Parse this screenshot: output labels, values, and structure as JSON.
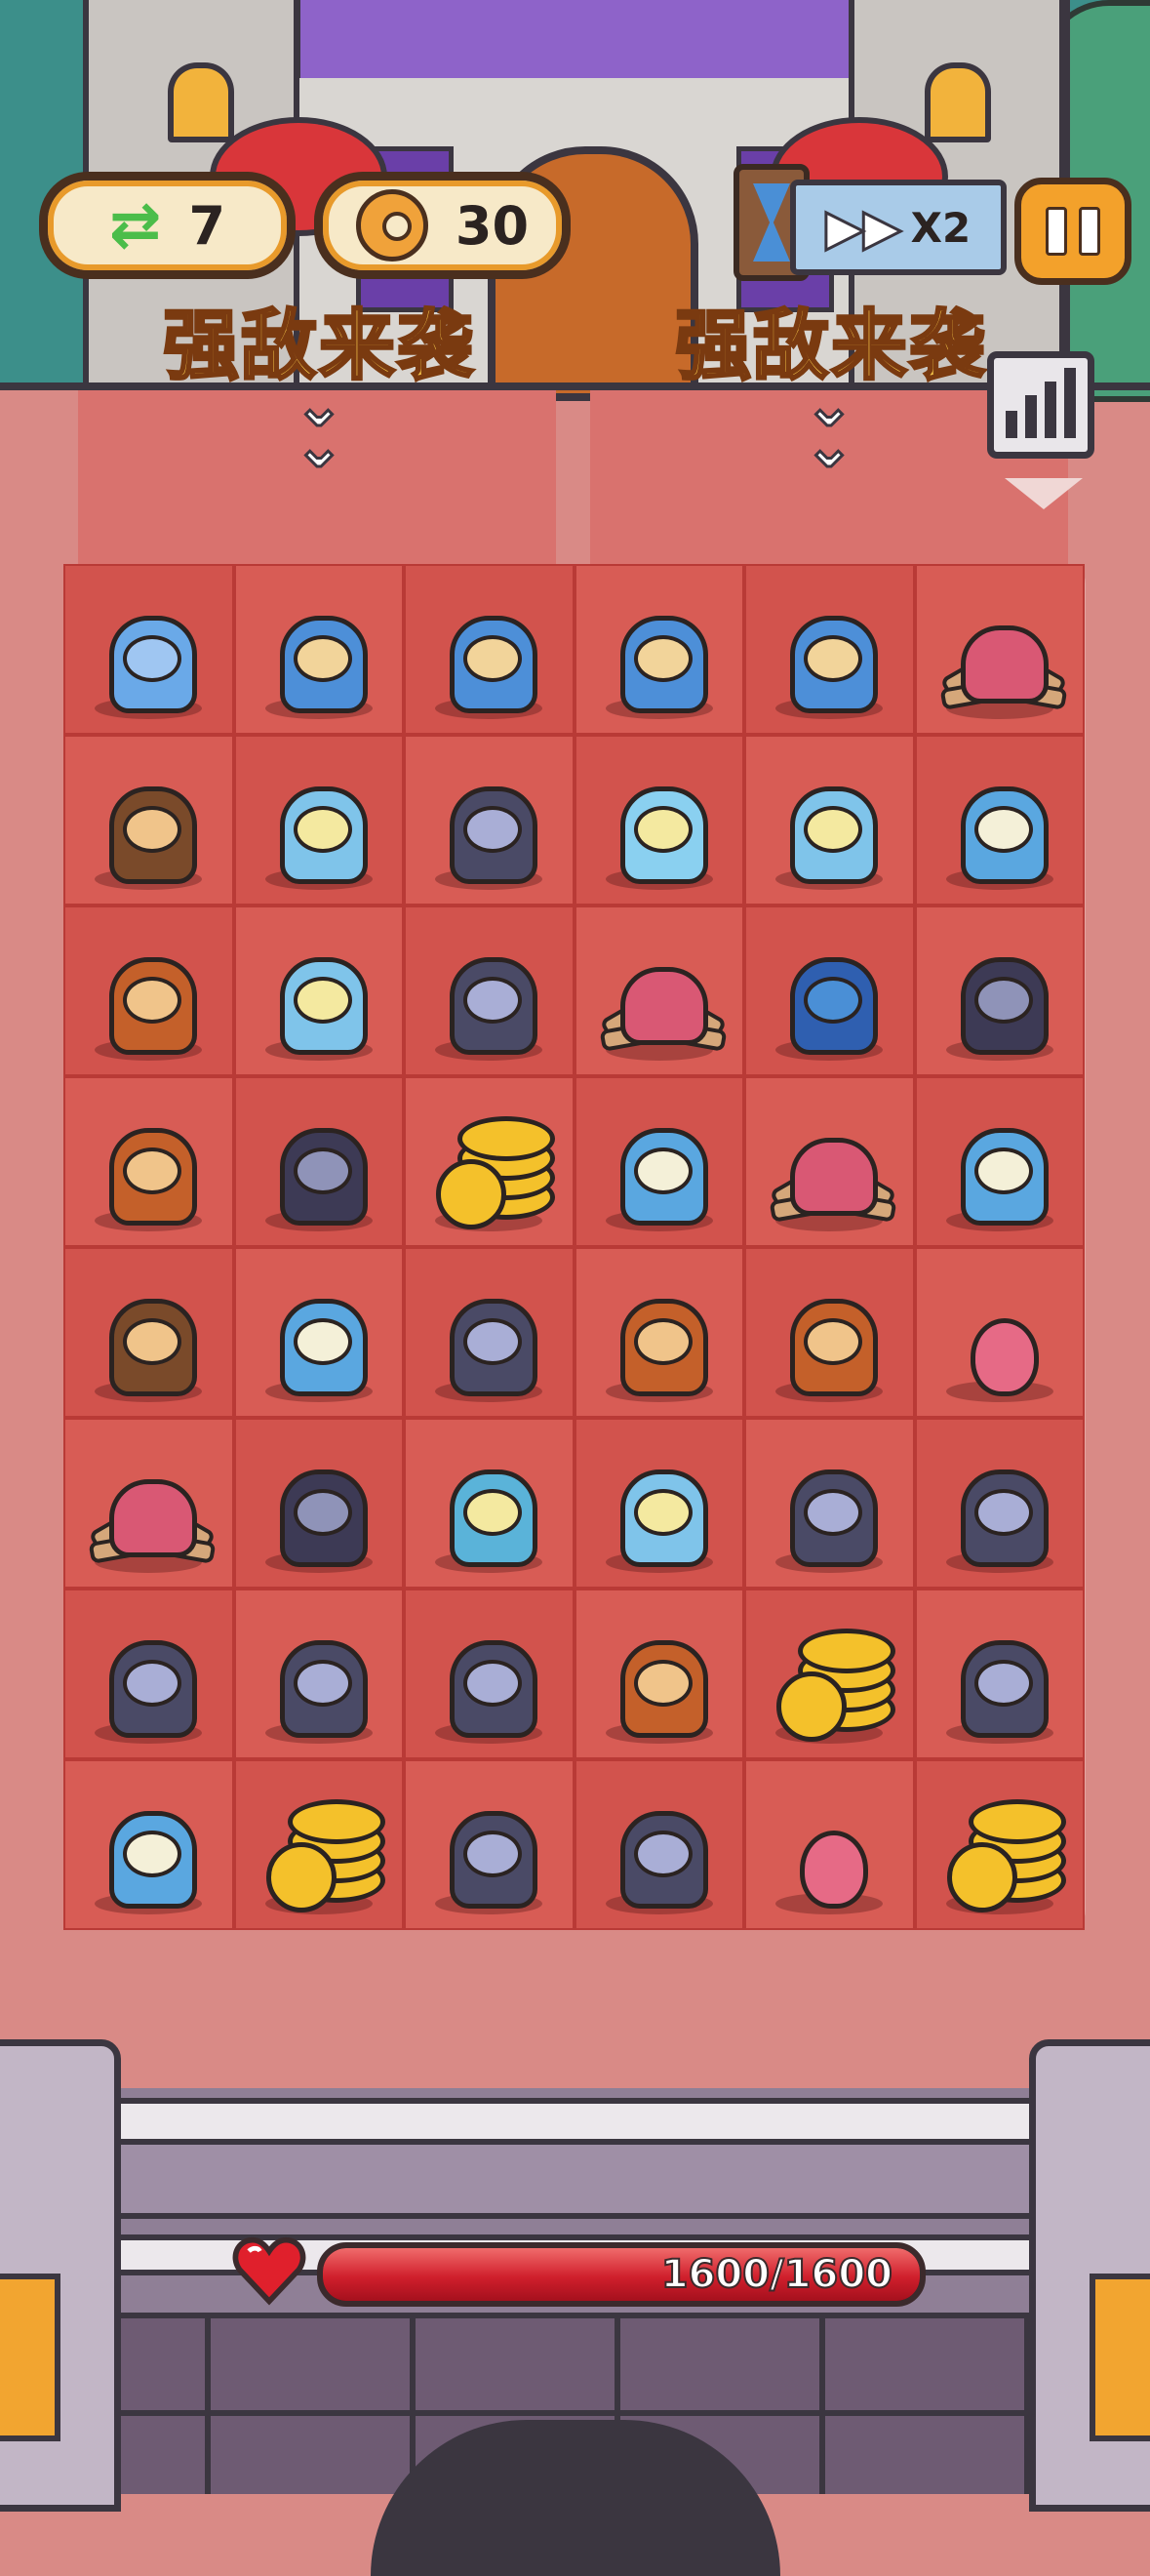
{
  "hud": {
    "swaps": "7",
    "energy": "30",
    "speed_label": "X2",
    "swap_icon": "swap-arrows-icon",
    "energy_icon": "sun-moon-icon",
    "hourglass_icon": "hourglass-icon",
    "fast_forward_icon": "fast-forward-icon",
    "pause_icon": "pause-icon",
    "stats_icon": "stats-chart-icon"
  },
  "warnings": [
    "强敌来袭",
    "强敌来袭"
  ],
  "colors": {
    "cell": "#d2534d",
    "coin": "#f4c12b",
    "hp": "#d01f2c",
    "warning_text": "#f5c74a"
  },
  "grid": {
    "rows": [
      [
        "frost-dragon",
        "ice-knight",
        "ice-knight",
        "ice-knight",
        "ice-knight",
        "spider"
      ],
      [
        "imp",
        "ice-mage",
        "vampire-horned",
        "crystal-knight",
        "ice-mage",
        "hooded-mage"
      ],
      [
        "antler-warrior",
        "ice-mage",
        "vampire-horned",
        "spider-small",
        "armored-knight",
        "demon-lord"
      ],
      [
        "antler-warrior",
        "demon-lord",
        "coins",
        "hooded-mage",
        "spider",
        "hooded-mage"
      ],
      [
        "imp",
        "hooded-mage",
        "vampire-horned",
        "horned-imp",
        "horned-imp",
        "spike-slime"
      ],
      [
        "spider-small",
        "demon-lord",
        "ice-queen",
        "ice-mage",
        "vampire",
        "vampire"
      ],
      [
        "vampire-horned",
        "vampire",
        "vampire",
        "horned-imp",
        "coins",
        "vampire"
      ],
      [
        "hooded-mage",
        "coins",
        "vampire",
        "vampire",
        "spike-slime",
        "coins"
      ]
    ]
  },
  "hp": {
    "current": 1600,
    "max": 1600,
    "label": "1600/1600",
    "icon": "heart-icon"
  }
}
